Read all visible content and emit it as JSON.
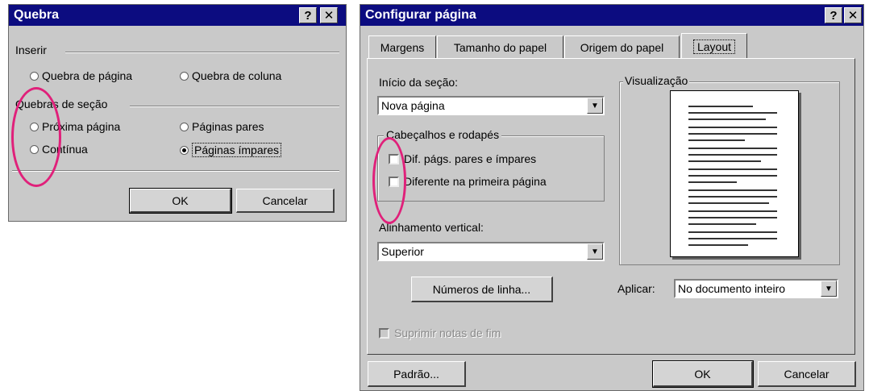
{
  "quebra": {
    "title": "Quebra",
    "help_label": "?",
    "close_label": "✕",
    "inserir_label": "Inserir",
    "radio_quebra_pagina": "Quebra de página",
    "radio_quebra_coluna": "Quebra de coluna",
    "secao_label": "Quebras de seção",
    "radio_proxima": "Próxima página",
    "radio_continua": "Contínua",
    "radio_pares": "Páginas pares",
    "radio_impares": "Páginas ímpares",
    "ok_label": "OK",
    "cancel_label": "Cancelar"
  },
  "config": {
    "title": "Configurar página",
    "help_label": "?",
    "close_label": "✕",
    "tabs": [
      "Margens",
      "Tamanho do papel",
      "Origem do papel",
      "Layout"
    ],
    "inicio_label": "Início da seção:",
    "inicio_value": "Nova página",
    "cabecalhos_label": "Cabeçalhos e rodapés",
    "check_dif_pags": "Dif. págs. pares e ímpares",
    "check_primeira": "Diferente na primeira página",
    "alinhamento_label": "Alinhamento vertical:",
    "alinhamento_value": "Superior",
    "visualizacao_label": "Visualização",
    "numeros_button": "Números de linha...",
    "aplicar_label": "Aplicar:",
    "aplicar_value": "No documento inteiro",
    "suprimir_label": "Suprimir notas de fim",
    "padrao_button": "Padrão...",
    "ok_label": "OK",
    "cancel_label": "Cancelar"
  },
  "colors": {
    "titlebar": "#0c0c80",
    "face": "#c9c9c9",
    "annotation": "#e0207a"
  }
}
